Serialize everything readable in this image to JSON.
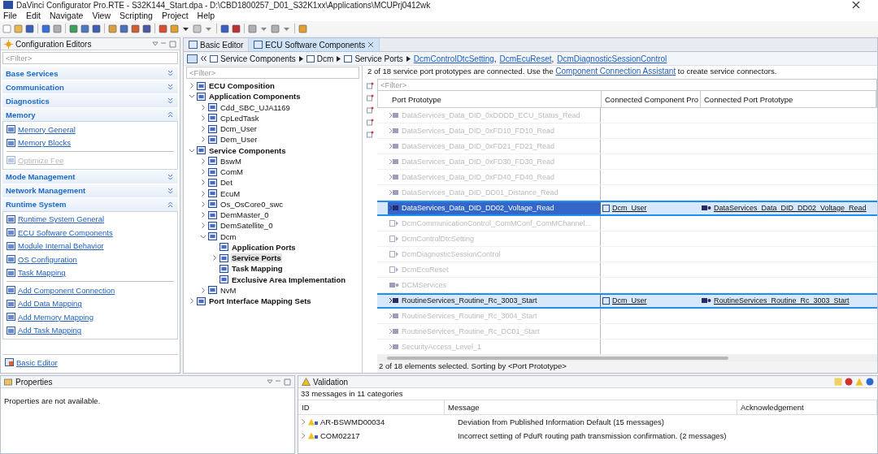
{
  "window": {
    "title": "DaVinci Configurator Pro.RTE - S32K144_Start.dpa - D:\\CBD1800257_D01_S32K1xx\\Applications\\MCUPrj0412wk"
  },
  "menu": [
    "File",
    "Edit",
    "Navigate",
    "View",
    "Scripting",
    "Project",
    "Help"
  ],
  "config_editors": {
    "title": "Configuration Editors",
    "filter": {
      "placeholder": "<Filter>"
    },
    "sections": [
      {
        "title": "Base Services",
        "expanded": false
      },
      {
        "title": "Communication",
        "expanded": false
      },
      {
        "title": "Diagnostics",
        "expanded": false
      },
      {
        "title": "Memory",
        "expanded": true,
        "groups": [
          [
            {
              "label": "Memory General",
              "disabled": false
            },
            {
              "label": "Memory Blocks",
              "disabled": false
            }
          ],
          [
            {
              "label": "Optimize Fee",
              "disabled": true
            }
          ]
        ]
      },
      {
        "title": "Mode Management",
        "expanded": false
      },
      {
        "title": "Network Management",
        "expanded": false
      },
      {
        "title": "Runtime System",
        "expanded": true,
        "groups": [
          [
            {
              "label": "Runtime System General",
              "disabled": false
            },
            {
              "label": "ECU Software Components",
              "disabled": false
            },
            {
              "label": "Module Internal Behavior",
              "disabled": false
            },
            {
              "label": "OS Configuration",
              "disabled": false
            },
            {
              "label": "Task Mapping",
              "disabled": false
            }
          ],
          [
            {
              "label": "Add Component Connection",
              "disabled": false
            },
            {
              "label": "Add Data Mapping",
              "disabled": false
            },
            {
              "label": "Add Memory Mapping",
              "disabled": false
            },
            {
              "label": "Add Task Mapping",
              "disabled": false
            }
          ]
        ]
      }
    ],
    "footer_link": "Basic Editor"
  },
  "editor_tabs": [
    {
      "label": "Basic Editor",
      "selected": false
    },
    {
      "label": "ECU Software Components",
      "selected": true
    }
  ],
  "breadcrumb": {
    "items": [
      "Service Components",
      "Dcm",
      "Service Ports"
    ],
    "links": [
      "DcmControlDtcSetting",
      "DcmEcuReset",
      "DcmDiagnosticSessionControl"
    ],
    "link_separator": ","
  },
  "tree": {
    "filter": {
      "placeholder": "<Filter>"
    },
    "nodes": [
      {
        "label": "ECU Composition",
        "bold": true,
        "expanded": false,
        "selected": false
      },
      {
        "label": "Application Components",
        "bold": true,
        "expanded": true,
        "selected": false,
        "children": [
          {
            "label": "Cdd_SBC_UJA1169",
            "bold": false,
            "expanded": false,
            "selected": false
          },
          {
            "label": "CpLedTask",
            "bold": false,
            "expanded": false,
            "selected": false
          },
          {
            "label": "Dcm_User",
            "bold": false,
            "expanded": false,
            "selected": false
          },
          {
            "label": "Dem_User",
            "bold": false,
            "expanded": false,
            "selected": false
          }
        ]
      },
      {
        "label": "Service Components",
        "bold": true,
        "expanded": true,
        "selected": false,
        "children": [
          {
            "label": "BswM",
            "bold": false,
            "expanded": false,
            "selected": false
          },
          {
            "label": "ComM",
            "bold": false,
            "expanded": false,
            "selected": false
          },
          {
            "label": "Det",
            "bold": false,
            "expanded": false,
            "selected": false
          },
          {
            "label": "EcuM",
            "bold": false,
            "expanded": false,
            "selected": false
          },
          {
            "label": "Os_OsCore0_swc",
            "bold": false,
            "expanded": false,
            "selected": false
          },
          {
            "label": "DemMaster_0",
            "bold": false,
            "expanded": false,
            "selected": false
          },
          {
            "label": "DemSatellite_0",
            "bold": false,
            "expanded": false,
            "selected": false
          },
          {
            "label": "Dcm",
            "bold": false,
            "expanded": true,
            "selected": false,
            "children": [
              {
                "label": "Application Ports",
                "bold": true,
                "selected": false
              },
              {
                "label": "Service Ports",
                "bold": true,
                "expanded": false,
                "selected": true
              },
              {
                "label": "Task Mapping",
                "bold": true,
                "selected": false
              },
              {
                "label": "Exclusive Area Implementation",
                "bold": true,
                "selected": false
              }
            ]
          },
          {
            "label": "NvM",
            "bold": false,
            "expanded": false,
            "selected": false
          }
        ]
      },
      {
        "label": "Port Interface Mapping Sets",
        "bold": true,
        "expanded": false,
        "selected": false
      }
    ]
  },
  "info": {
    "before": "2 of 18 service port prototypes are connected. Use the",
    "link": "Component Connection Assistant",
    "after": "to create service connectors."
  },
  "table": {
    "filter": {
      "placeholder": "<Filter>"
    },
    "columns": [
      "Port Prototype",
      "Connected Component Pro",
      "Connected Port Prototype"
    ],
    "rows": [
      {
        "kind": "receiver",
        "port": "DataServices_Data_DID_0xDDDD_ECU_Status_Read",
        "connected": false,
        "selected": false,
        "focused": false
      },
      {
        "kind": "receiver",
        "port": "DataServices_Data_DID_0xFD10_FD10_Read",
        "connected": false,
        "selected": false,
        "focused": false
      },
      {
        "kind": "receiver",
        "port": "DataServices_Data_DID_0xFD21_FD21_Read",
        "connected": false,
        "selected": false,
        "focused": false
      },
      {
        "kind": "receiver",
        "port": "DataServices_Data_DID_0xFD30_FD30_Read",
        "connected": false,
        "selected": false,
        "focused": false
      },
      {
        "kind": "receiver",
        "port": "DataServices_Data_DID_0xFD40_FD40_Read",
        "connected": false,
        "selected": false,
        "focused": false
      },
      {
        "kind": "receiver",
        "port": "DataServices_Data_DID_DD01_Distance_Read",
        "connected": false,
        "selected": false,
        "focused": false
      },
      {
        "kind": "receiver",
        "port": "DataServices_Data_DID_DD02_Voltage_Read",
        "component": "Dcm_User",
        "connected_port": "DataServices_Data_DID_DD02_Voltage_Read",
        "connected": true,
        "selected": true,
        "focused": true
      },
      {
        "kind": "server",
        "port": "DcmCommunicationControl_ComMConf_ComMChannel...",
        "connected": false,
        "selected": false,
        "focused": false
      },
      {
        "kind": "server",
        "port": "DcmControlDtcSetting",
        "connected": false,
        "selected": false,
        "focused": false
      },
      {
        "kind": "server",
        "port": "DcmDiagnosticSessionControl",
        "connected": false,
        "selected": false,
        "focused": false
      },
      {
        "kind": "server",
        "port": "DcmEcuReset",
        "connected": false,
        "selected": false,
        "focused": false
      },
      {
        "kind": "mode",
        "port": "DCMServices",
        "connected": false,
        "selected": false,
        "focused": false
      },
      {
        "kind": "receiver",
        "port": "RoutineServices_Routine_Rc_3003_Start",
        "component": "Dcm_User",
        "connected_port": "RoutineServices_Routine_Rc_3003_Start",
        "connected": true,
        "selected": true,
        "focused": false
      },
      {
        "kind": "receiver",
        "port": "RoutineServices_Routine_Rc_3004_Start",
        "connected": false,
        "selected": false,
        "focused": false
      },
      {
        "kind": "receiver",
        "port": "RoutineServices_Routine_Rc_DC01_Start",
        "connected": false,
        "selected": false,
        "focused": false
      },
      {
        "kind": "receiver",
        "port": "SecurityAccess_Level_1",
        "connected": false,
        "selected": false,
        "focused": false
      }
    ],
    "status": "2 of 18 elements selected. Sorting by <Port Prototype>"
  },
  "properties": {
    "title": "Properties",
    "message": "Properties are not available."
  },
  "validation": {
    "title": "Validation",
    "summary": "33 messages in 11 categories",
    "columns": [
      "ID",
      "Message",
      "Acknowledgement"
    ],
    "rows": [
      {
        "id": "AR-BSWMD00034",
        "message": "Deviation from Published Information Default (15 messages)"
      },
      {
        "id": "COM02217",
        "message": "Incorrect setting of PduR routing path transmission confirmation. (2 messages)"
      }
    ]
  }
}
